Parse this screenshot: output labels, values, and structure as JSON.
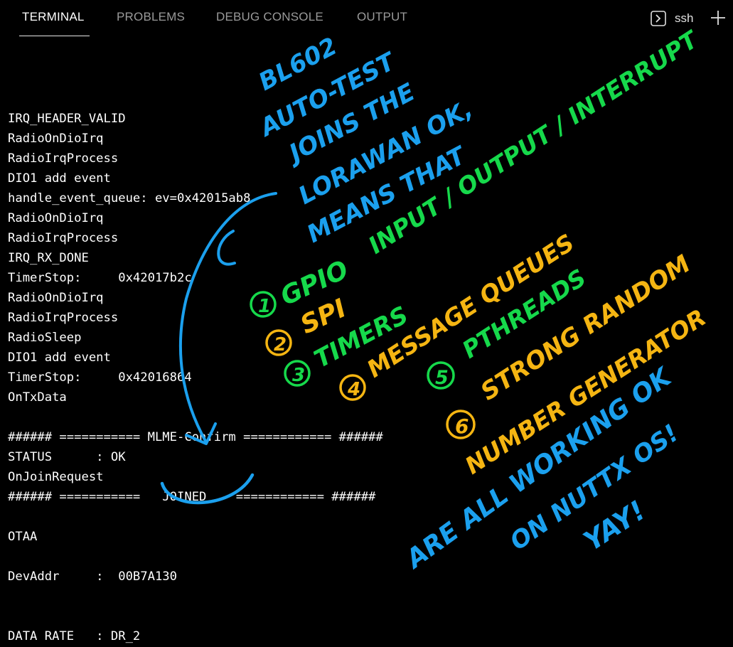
{
  "tabs": [
    {
      "label": "TERMINAL",
      "active": true
    },
    {
      "label": "PROBLEMS",
      "active": false
    },
    {
      "label": "DEBUG CONSOLE",
      "active": false
    },
    {
      "label": "OUTPUT",
      "active": false
    }
  ],
  "shell": {
    "label": "ssh",
    "icon": "terminal-prompt-icon"
  },
  "actions": {
    "new_terminal_icon": "plus-icon"
  },
  "terminal_lines": [
    "",
    "IRQ_HEADER_VALID",
    "RadioOnDioIrq",
    "RadioIrqProcess",
    "DIO1 add event",
    "handle_event_queue: ev=0x42015ab8",
    "RadioOnDioIrq",
    "RadioIrqProcess",
    "IRQ_RX_DONE",
    "TimerStop:     0x42017b2c",
    "RadioOnDioIrq",
    "RadioIrqProcess",
    "RadioSleep",
    "DIO1 add event",
    "TimerStop:     0x42016864",
    "OnTxData",
    "",
    "###### =========== MLME-Confirm ============ ######",
    "STATUS      : OK",
    "OnJoinRequest",
    "###### ===========   JOINED    ============ ######",
    "",
    "OTAA",
    "",
    "DevAddr     :  00B7A130",
    "",
    "",
    "DATA RATE   : DR_2"
  ],
  "annotation": {
    "colors": {
      "blue": "#1ba0ee",
      "green": "#16d94b",
      "orange": "#f5b512"
    },
    "title_lines": [
      "BL602",
      "AUTO-TEST",
      "JOINS THE",
      "LORAWAN OK,",
      "MEANS THAT"
    ],
    "io_line": "INPUT / OUTPUT / INTERRUPT",
    "items": [
      {
        "num": "1",
        "text": "GPIO"
      },
      {
        "num": "2",
        "text": "SPI"
      },
      {
        "num": "3",
        "text": "TIMERS"
      },
      {
        "num": "4",
        "text": "MESSAGE QUEUES"
      },
      {
        "num": "5",
        "text": "PTHREADS"
      },
      {
        "num": "6",
        "text": "STRONG RANDOM"
      }
    ],
    "item6_line2": "NUMBER GENERATOR",
    "closing_lines": [
      "ARE ALL WORKING OK",
      "ON NUTTX OS!",
      "YAY!"
    ]
  }
}
